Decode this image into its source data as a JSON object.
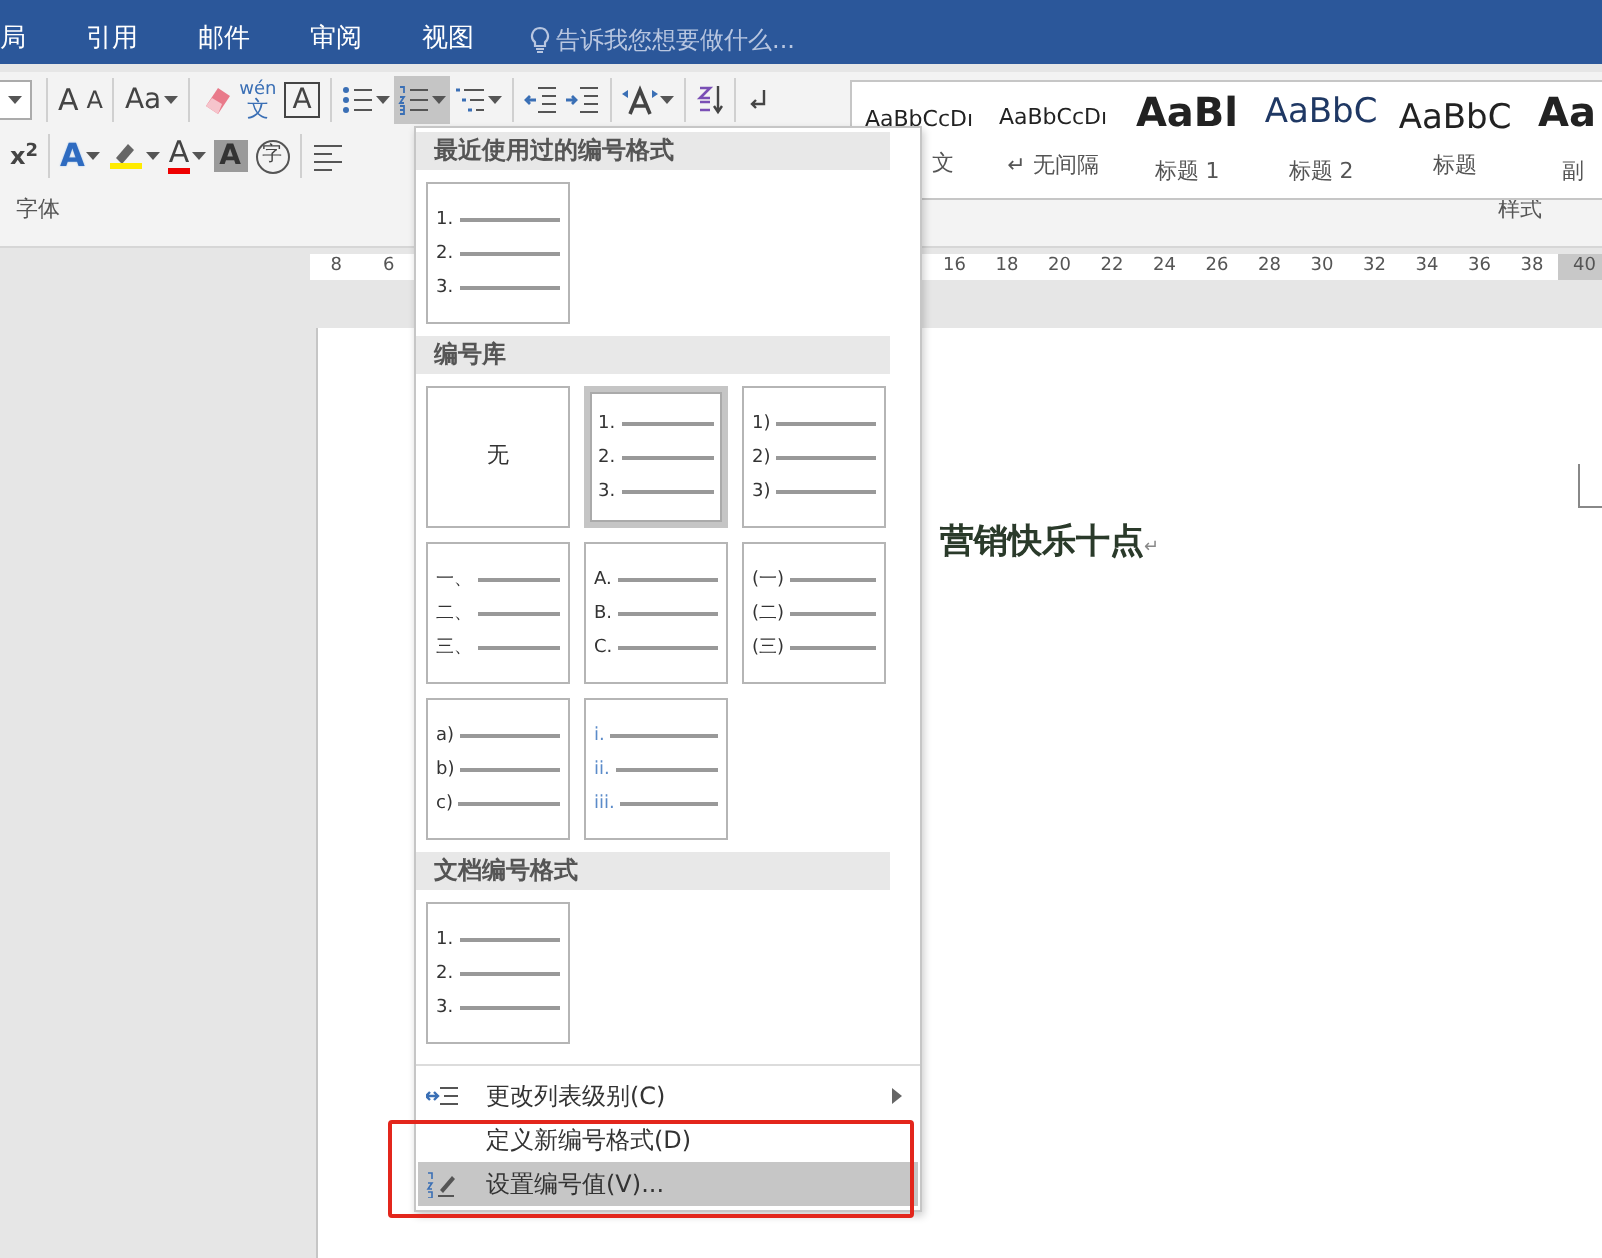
{
  "tabs": [
    {
      "label": "局",
      "selected": false
    },
    {
      "label": "引用",
      "selected": false
    },
    {
      "label": "邮件",
      "selected": false
    },
    {
      "label": "审阅",
      "selected": false
    },
    {
      "label": "视图",
      "selected": false
    }
  ],
  "tell_me": {
    "placeholder": "告诉我您想要做什么..."
  },
  "ribbon": {
    "row_1": [
      {
        "kind": "font-size",
        "pressed": false,
        "caret": true
      },
      {
        "kind": "sep"
      },
      {
        "kind": "grow",
        "text": "A",
        "pressed": false,
        "caret": false
      },
      {
        "kind": "shrink",
        "text": "A",
        "pressed": false,
        "caret": false
      },
      {
        "kind": "sep"
      },
      {
        "kind": "case",
        "text": "Aa",
        "pressed": false,
        "caret": true
      },
      {
        "kind": "sep"
      },
      {
        "kind": "eraser",
        "pressed": false,
        "caret": false
      },
      {
        "kind": "phonetic",
        "text": "wén",
        "sub": "文",
        "pressed": false,
        "caret": false
      },
      {
        "kind": "border-char",
        "text": "A",
        "pressed": false,
        "caret": false
      },
      {
        "kind": "sep"
      },
      {
        "kind": "bullets",
        "pressed": false,
        "caret": true
      },
      {
        "kind": "numbering",
        "pressed": true,
        "caret": true
      },
      {
        "kind": "multilevel",
        "pressed": false,
        "caret": true
      },
      {
        "kind": "sep"
      },
      {
        "kind": "outdent",
        "pressed": false,
        "caret": false
      },
      {
        "kind": "indent",
        "pressed": false,
        "caret": false
      },
      {
        "kind": "sep"
      },
      {
        "kind": "spacing",
        "pressed": false,
        "caret": true
      },
      {
        "kind": "sep"
      },
      {
        "kind": "sort",
        "pressed": false,
        "caret": false
      },
      {
        "kind": "sep"
      },
      {
        "kind": "marks",
        "pressed": false,
        "caret": false
      }
    ],
    "row_2": [
      {
        "kind": "superscript",
        "text": "x$^{2}$",
        "pressed": false,
        "caret": false
      },
      {
        "kind": "sep"
      },
      {
        "kind": "effects",
        "text": "A",
        "pressed": false,
        "caret": true
      },
      {
        "kind": "highlighter",
        "pressed": false,
        "caret": true
      },
      {
        "kind": "font-color",
        "text": "A",
        "pressed": false,
        "caret": true
      },
      {
        "kind": "shading",
        "text": "A",
        "pressed": false,
        "caret": false
      },
      {
        "kind": "enclose",
        "text": "字",
        "pressed": false,
        "caret": false
      },
      {
        "kind": "sep"
      },
      {
        "kind": "align-left",
        "pressed": false,
        "caret": false
      }
    ],
    "font_group_label": "字体",
    "styles_group_label": "样式",
    "styles": [
      {
        "kind": "normal",
        "preview": "AaBbCcDı",
        "label": "文"
      },
      {
        "kind": "normal",
        "preview": "AaBbCcDı",
        "label": "↵ 无间隔"
      },
      {
        "kind": "heading1",
        "preview": "AaBl",
        "label": "标题 1"
      },
      {
        "kind": "heading2",
        "preview": "AaBbC",
        "label": "标题 2"
      },
      {
        "kind": "title",
        "preview": "AaBbC",
        "label": "标题"
      },
      {
        "kind": "heading1",
        "preview": "Aa",
        "label": "副"
      }
    ]
  },
  "ruler": {
    "left": [
      {
        "label": "8",
        "in_margin": false
      },
      {
        "label": "6",
        "in_margin": false
      }
    ],
    "right": [
      {
        "label": "16",
        "in_margin": false
      },
      {
        "label": "18",
        "in_margin": false
      },
      {
        "label": "20",
        "in_margin": false
      },
      {
        "label": "22",
        "in_margin": false
      },
      {
        "label": "24",
        "in_margin": false
      },
      {
        "label": "26",
        "in_margin": false
      },
      {
        "label": "28",
        "in_margin": false
      },
      {
        "label": "30",
        "in_margin": false
      },
      {
        "label": "32",
        "in_margin": false
      },
      {
        "label": "34",
        "in_margin": false
      },
      {
        "label": "36",
        "in_margin": false
      },
      {
        "label": "38",
        "in_margin": false
      },
      {
        "label": "40",
        "in_margin": true
      }
    ]
  },
  "document": {
    "heading": "营销快乐十点",
    "paragraph_mark": "↵"
  },
  "numbering_menu": {
    "sections": [
      {
        "title": "最近使用过的编号格式",
        "tiles": [
          {
            "kind": "list",
            "lines": [
              "1.",
              "2.",
              "3."
            ],
            "selected": false
          }
        ]
      },
      {
        "title": "编号库",
        "tiles": [
          {
            "kind": "none",
            "label": "无",
            "selected": false
          },
          {
            "kind": "list",
            "lines": [
              "1.",
              "2.",
              "3."
            ],
            "selected": true
          },
          {
            "kind": "list",
            "lines": [
              "1)",
              "2)",
              "3)"
            ],
            "selected": false
          },
          {
            "kind": "list",
            "lines": [
              "一、",
              "二、",
              "三、"
            ],
            "selected": false
          },
          {
            "kind": "list",
            "lines": [
              "A.",
              "B.",
              "C."
            ],
            "selected": false
          },
          {
            "kind": "list",
            "lines": [
              "(一)",
              "(二)",
              "(三)"
            ],
            "selected": false
          },
          {
            "kind": "list",
            "lines": [
              "a)",
              "b)",
              "c)"
            ],
            "selected": false
          },
          {
            "kind": "roman",
            "lines": [
              "i.",
              "ii.",
              "iii."
            ],
            "selected": false
          }
        ]
      },
      {
        "title": "文档编号格式",
        "tiles": [
          {
            "kind": "list",
            "lines": [
              "1.",
              "2.",
              "3."
            ],
            "selected": false
          }
        ]
      }
    ],
    "commands": [
      {
        "kind": "level",
        "label": "更改列表级别(C)",
        "submenu": true,
        "highlighted": false
      },
      {
        "kind": "define",
        "label": "定义新编号格式(D)",
        "submenu": false,
        "highlighted": false
      },
      {
        "kind": "value",
        "label": "设置编号值(V)...",
        "submenu": false,
        "highlighted": true
      }
    ]
  },
  "highlight_frame": true
}
